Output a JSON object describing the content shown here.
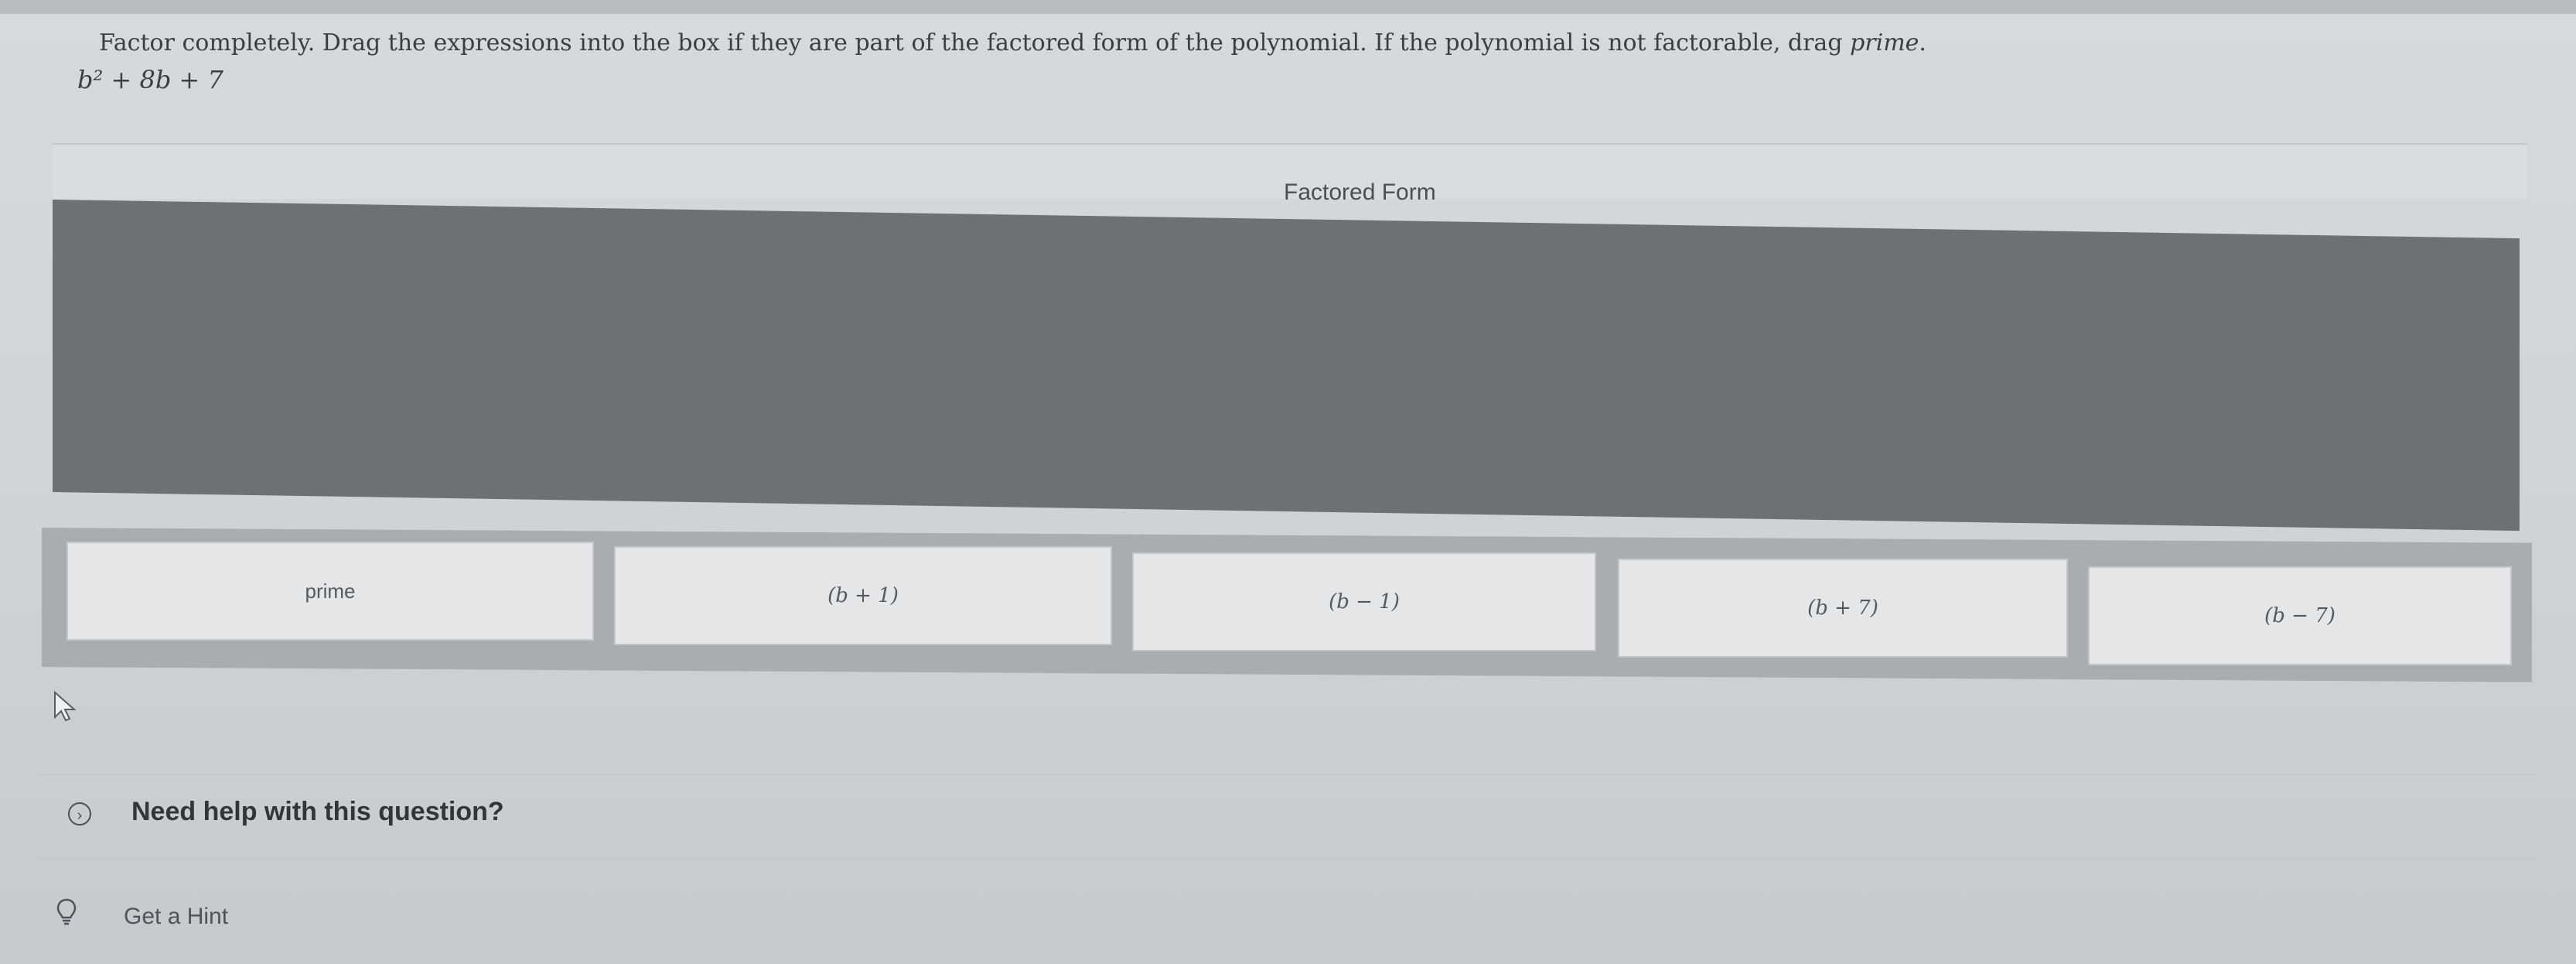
{
  "question": {
    "instruction_main": "Factor completely. Drag the expressions into the box if they are part of the factored form of the polynomial. If the polynomial is not factorable, drag ",
    "instruction_emphasis": "prime",
    "instruction_end": ".",
    "polynomial": "b² + 8b + 7"
  },
  "factored_form": {
    "label": "Factored Form"
  },
  "answer_bank": {
    "chips": [
      {
        "label": "prime"
      },
      {
        "label": "(b + 1)"
      },
      {
        "label": "(b − 1)"
      },
      {
        "label": "(b + 7)"
      },
      {
        "label": "(b − 7)"
      }
    ]
  },
  "help": {
    "toggle_icon": "chevron-circle-icon",
    "label": "Need help with this question?"
  },
  "hint": {
    "icon": "lightbulb-icon",
    "label": "Get a Hint"
  }
}
